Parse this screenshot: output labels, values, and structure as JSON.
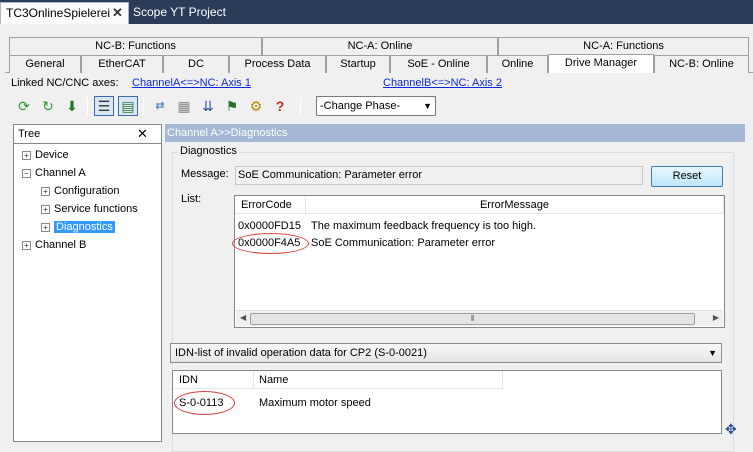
{
  "doc_tabs": {
    "active": "TC3OnlineSpielerei",
    "inactive": "Scope YT Project"
  },
  "top_tabs": [
    "NC-B: Functions",
    "NC-A: Online",
    "NC-A: Functions"
  ],
  "bottom_tabs": [
    "General",
    "EtherCAT",
    "DC",
    "Process Data",
    "Startup",
    "SoE - Online",
    "Online",
    "Drive Manager",
    "NC-B: Online"
  ],
  "linked": {
    "label": "Linked NC/CNC axes:",
    "channel_a": "ChannelA<=>NC: Axis 1",
    "channel_b": "ChannelB<=>NC: Axis 2"
  },
  "toolbar": {
    "phase": "-Change Phase-"
  },
  "tree": {
    "title": "Tree",
    "items": [
      "Device",
      "Channel A",
      "Configuration",
      "Service functions",
      "Diagnostics",
      "Channel B"
    ]
  },
  "diag": {
    "header": "Channel A>>Diagnostics",
    "group": "Diagnostics",
    "message_label": "Message:",
    "message": "SoE Communication: Parameter error",
    "reset": "Reset",
    "list_label": "List:",
    "columns": [
      "ErrorCode",
      "ErrorMessage"
    ],
    "rows": [
      {
        "code": "0x0000FD15",
        "msg": "The maximum feedback frequency is too high."
      },
      {
        "code": "0x0000F4A5",
        "msg": "SoE Communication: Parameter error"
      }
    ]
  },
  "idn": {
    "select": "IDN-list of invalid operation data for CP2 (S-0-0021)",
    "columns": [
      "IDN",
      "Name"
    ],
    "rows": [
      {
        "idn": "S-0-0113",
        "name": "Maximum motor speed"
      }
    ]
  }
}
